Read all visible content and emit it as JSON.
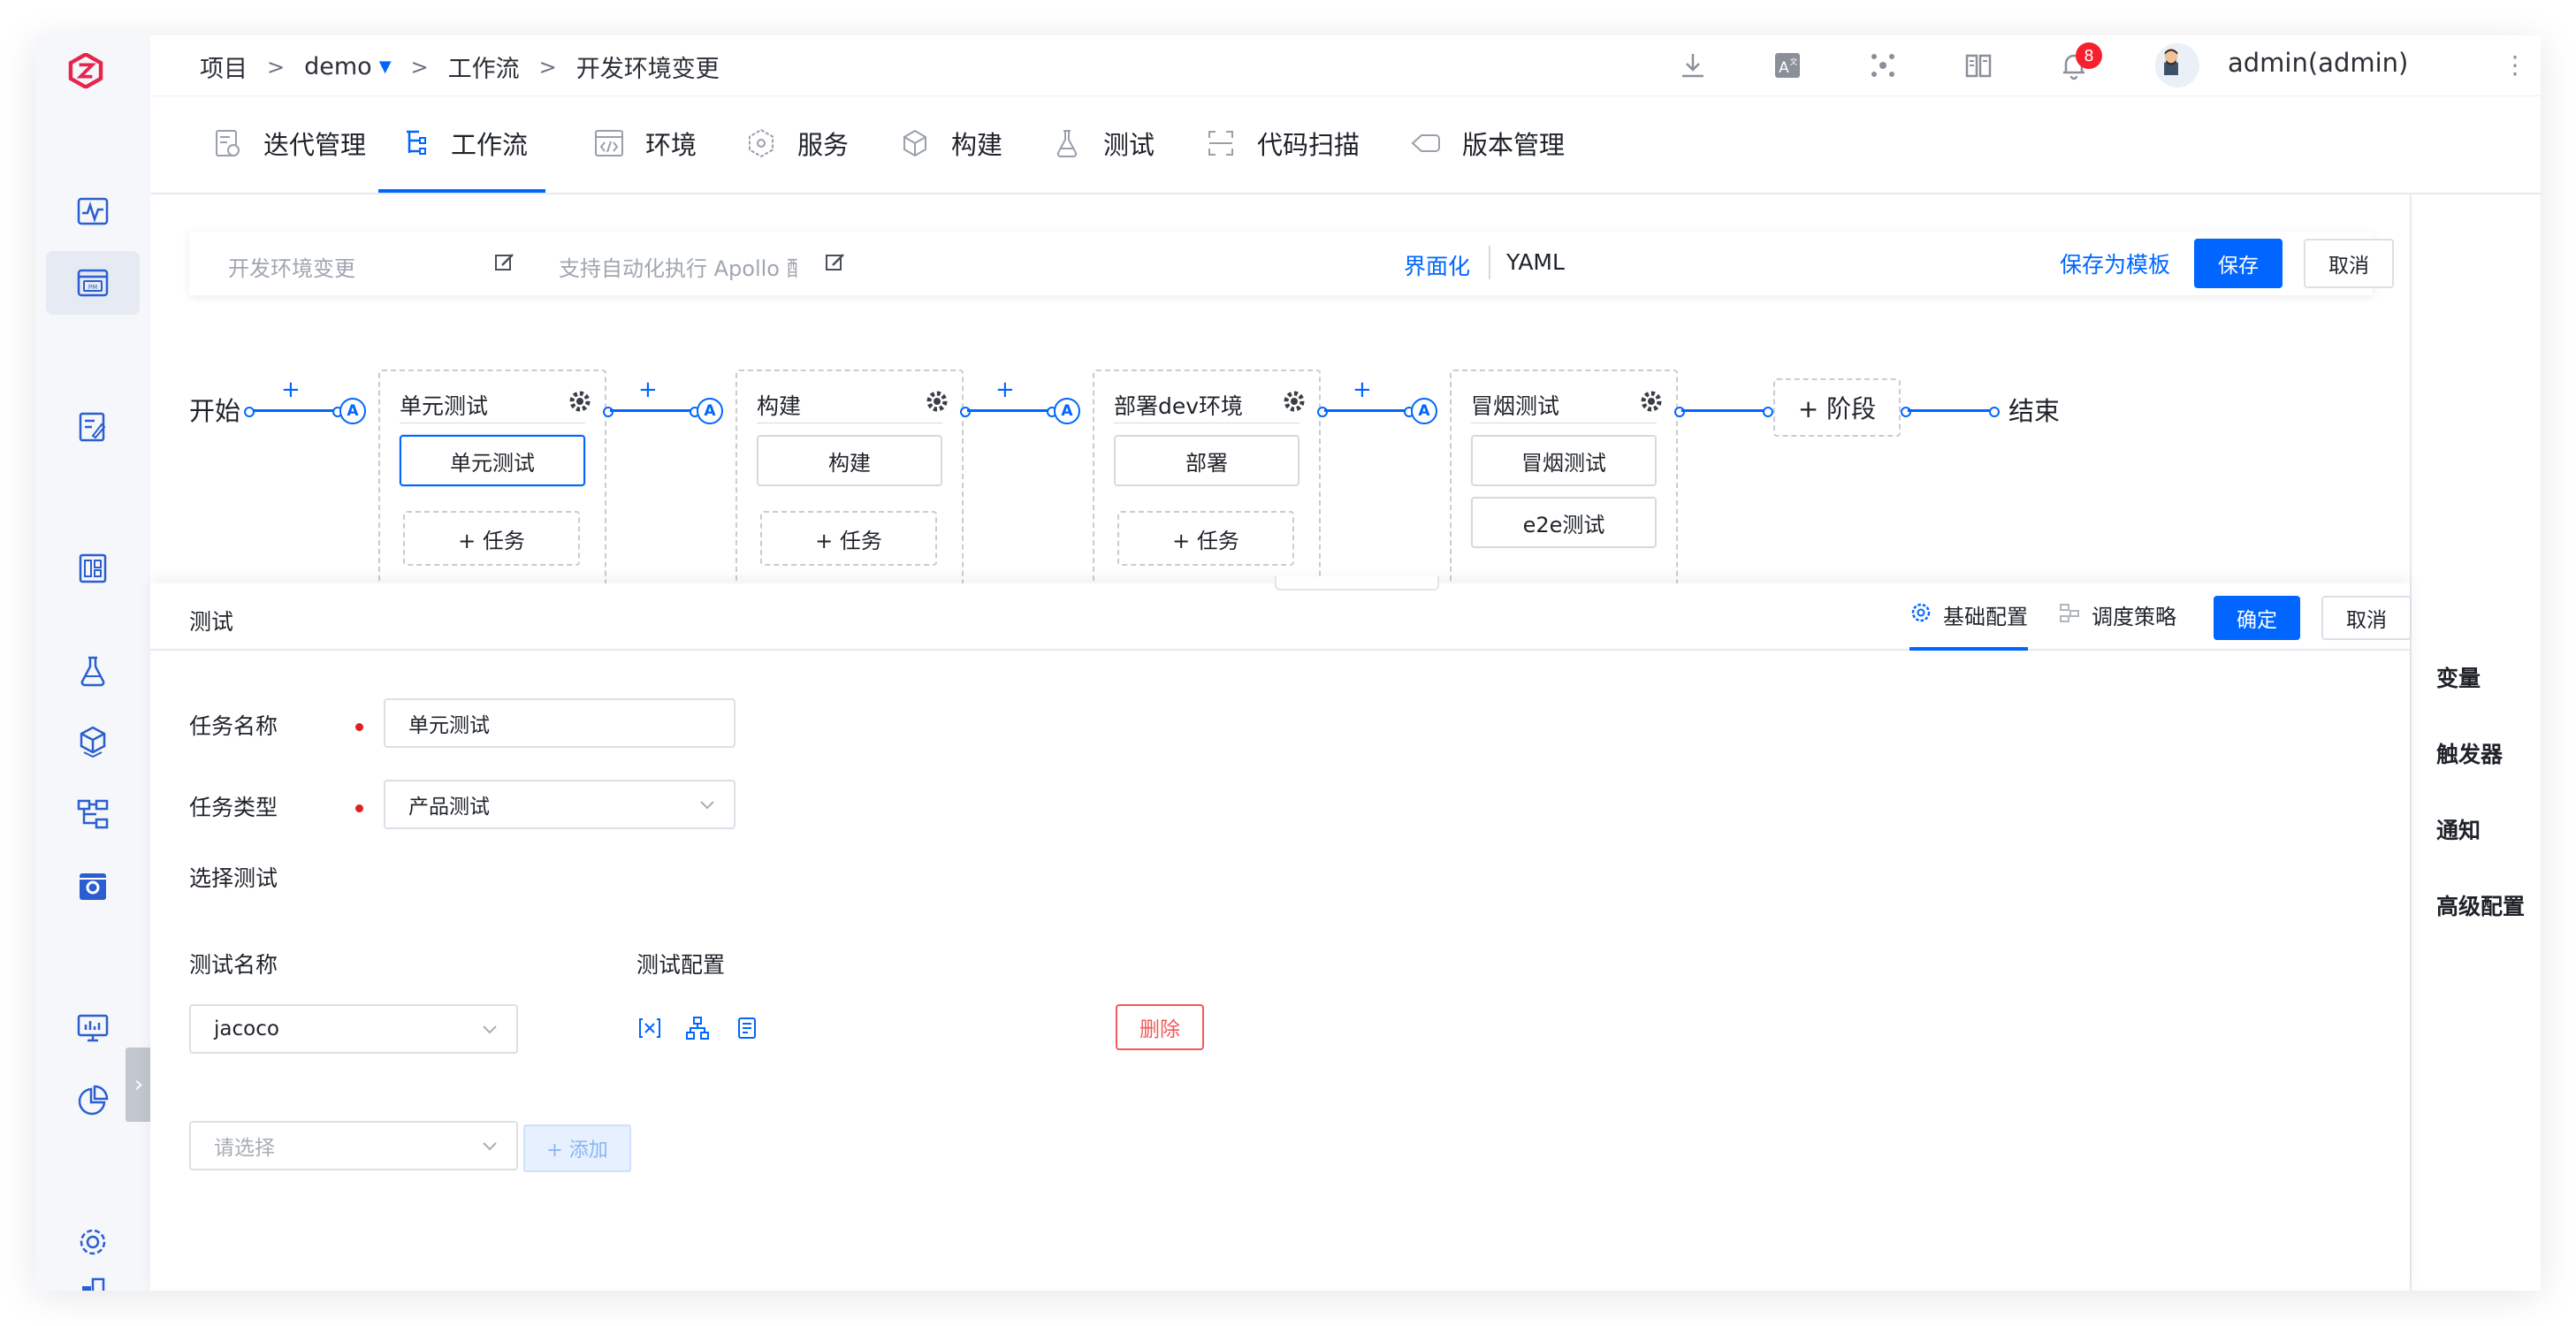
{
  "breadcrumb": {
    "root": "项目",
    "project": "demo",
    "section": "工作流",
    "current": "开发环境变更",
    "separator": ">"
  },
  "header": {
    "notification_count": "8",
    "user": "admin(admin)"
  },
  "nav": {
    "tabs": [
      {
        "label": "迭代管理",
        "icon": "iteration-icon"
      },
      {
        "label": "工作流",
        "icon": "workflow-icon"
      },
      {
        "label": "环境",
        "icon": "environment-icon"
      },
      {
        "label": "服务",
        "icon": "service-icon"
      },
      {
        "label": "构建",
        "icon": "build-icon"
      },
      {
        "label": "测试",
        "icon": "test-flask-icon"
      },
      {
        "label": "代码扫描",
        "icon": "code-scan-icon"
      },
      {
        "label": "版本管理",
        "icon": "version-icon"
      }
    ],
    "active": "工作流"
  },
  "editor": {
    "name": "开发环境变更",
    "description": "支持自动化执行 Apollo 配",
    "mode_visual": "界面化",
    "mode_yaml": "YAML",
    "save_template": "保存为模板",
    "save": "保存",
    "cancel": "取消"
  },
  "pipeline": {
    "start": "开始",
    "end": "结束",
    "plus": "+",
    "auto_badge": "A",
    "stages": [
      {
        "name": "单元测试",
        "jobs": [
          "单元测试"
        ],
        "add_task": "+ 任务"
      },
      {
        "name": "构建",
        "jobs": [
          "构建"
        ],
        "add_task": "+ 任务"
      },
      {
        "name": "部署dev环境",
        "jobs": [
          "部署"
        ],
        "add_task": "+ 任务"
      },
      {
        "name": "冒烟测试",
        "jobs": [
          "冒烟测试",
          "e2e测试"
        ],
        "add_task": ""
      }
    ],
    "add_stage": "+ 阶段"
  },
  "side_panel": {
    "items": [
      "变量",
      "触发器",
      "通知",
      "高级配置"
    ]
  },
  "job_panel": {
    "title": "测试",
    "tabs": [
      "基础配置",
      "调度策略"
    ],
    "confirm": "确定",
    "cancel": "取消",
    "fields": {
      "task_name_label": "任务名称",
      "task_name_value": "单元测试",
      "task_type_label": "任务类型",
      "task_type_value": "产品测试"
    },
    "select_test_label": "选择测试",
    "columns": {
      "name": "测试名称",
      "config": "测试配置"
    },
    "row": {
      "test_name": "jacoco",
      "delete": "删除"
    },
    "new_select_placeholder": "请选择",
    "add": "+ 添加"
  },
  "colors": {
    "primary": "#0066ff",
    "danger": "#f15a5a",
    "badge": "#f5222d"
  }
}
